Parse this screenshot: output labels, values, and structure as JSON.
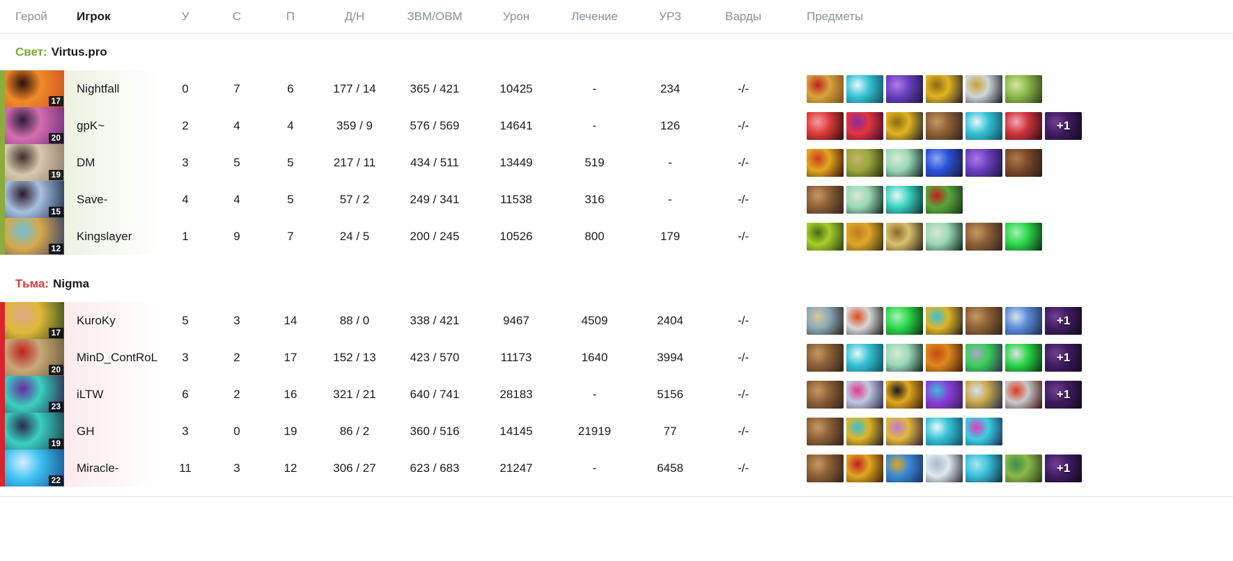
{
  "columns": {
    "hero": "Герой",
    "player": "Игрок",
    "kills": "У",
    "deaths": "С",
    "assists": "П",
    "last_hits_denies": "Д/Н",
    "gpm_xpm": "ЗВМ/ОВМ",
    "damage": "Урон",
    "healing": "Лечение",
    "hero_damage": "УРЗ",
    "wards": "Варды",
    "items": "Предметы"
  },
  "colors": {
    "radiant": "#7aa832",
    "dire": "#e2373f",
    "radiant_bar": "#8aad3b",
    "dire_bar": "#d9232e",
    "radiant_row": "#e7eed9",
    "dire_row": "#fae3e5",
    "header_text": "#8b9099",
    "body_text": "#1b1b1b"
  },
  "teams": [
    {
      "side_label": "Свет:",
      "side": "radiant",
      "name": "Virtus.pro",
      "players": [
        {
          "name": "Nightfall",
          "level": "17",
          "hero_colors": [
            "#d1521c",
            "#f08a2a",
            "#2a0f08"
          ],
          "kills": "0",
          "deaths": "7",
          "assists": "6",
          "last_hits_denies": "177 / 14",
          "gpm_xpm": "365 / 421",
          "damage": "10425",
          "healing": "-",
          "hero_damage": "234",
          "wards": "-/-",
          "items": [
            {
              "colors": [
                "#7a4a1d",
                "#d8a43a",
                "#c02020"
              ]
            },
            {
              "colors": [
                "#0e4a58",
                "#35c3d6",
                "#eaf7f9"
              ]
            },
            {
              "colors": [
                "#1a1438",
                "#6a3fbf",
                "#b07ae8"
              ]
            },
            {
              "colors": [
                "#1a1a2a",
                "#e0b422",
                "#8d6a12"
              ]
            },
            {
              "colors": [
                "#0f1a22",
                "#cfd6d8",
                "#c9a23a"
              ]
            },
            {
              "colors": [
                "#2a3a18",
                "#8bb84a",
                "#d7e4a0"
              ]
            }
          ],
          "extra_items": null
        },
        {
          "name": "gpK~",
          "level": "20",
          "hero_colors": [
            "#6b2a7a",
            "#d46fae",
            "#2b1c3a"
          ],
          "kills": "2",
          "deaths": "4",
          "assists": "4",
          "last_hits_denies": "359 / 9",
          "gpm_xpm": "576 / 569",
          "damage": "14641",
          "healing": "-",
          "hero_damage": "126",
          "wards": "-/-",
          "items": [
            {
              "colors": [
                "#2a0c0c",
                "#e03b3b",
                "#f2a0a0"
              ]
            },
            {
              "colors": [
                "#3a0a2a",
                "#e2353f",
                "#8a2aa0"
              ]
            },
            {
              "colors": [
                "#1a1a2a",
                "#e0b422",
                "#8d6a12"
              ]
            },
            {
              "colors": [
                "#2e2018",
                "#8c6038",
                "#c79a62"
              ]
            },
            {
              "colors": [
                "#0e4a58",
                "#35c3d6",
                "#eaf7f9"
              ]
            },
            {
              "colors": [
                "#2a0c14",
                "#d0343f",
                "#f0a8b0"
              ]
            }
          ],
          "extra_items": "+1"
        },
        {
          "name": "DM",
          "level": "19",
          "hero_colors": [
            "#8a7a66",
            "#d8c8b0",
            "#3a3028"
          ],
          "kills": "3",
          "deaths": "5",
          "assists": "5",
          "last_hits_denies": "217 / 11",
          "gpm_xpm": "434 / 511",
          "damage": "13449",
          "healing": "519",
          "hero_damage": "-",
          "wards": "-/-",
          "items": [
            {
              "colors": [
                "#3a0c08",
                "#e0a820",
                "#d03a20"
              ]
            },
            {
              "colors": [
                "#2a2a12",
                "#9aa83a",
                "#c8b070"
              ]
            },
            {
              "colors": [
                "#0c2018",
                "#9ad8b8",
                "#d8e8d0"
              ]
            },
            {
              "colors": [
                "#1a1438",
                "#2a52d8",
                "#8aa8f0"
              ]
            },
            {
              "colors": [
                "#1a1438",
                "#6a3fbf",
                "#b07ae8"
              ]
            },
            {
              "colors": [
                "#2a1a12",
                "#7a4a2a",
                "#b07a48"
              ]
            }
          ],
          "extra_items": null
        },
        {
          "name": "Save-",
          "level": "15",
          "hero_colors": [
            "#1a2a4a",
            "#a8c0e0",
            "#2a1a2a"
          ],
          "kills": "4",
          "deaths": "4",
          "assists": "5",
          "last_hits_denies": "57 / 2",
          "gpm_xpm": "249 / 341",
          "damage": "11538",
          "healing": "316",
          "hero_damage": "-",
          "wards": "-/-",
          "items": [
            {
              "colors": [
                "#2e2018",
                "#8c6038",
                "#c79a62"
              ]
            },
            {
              "colors": [
                "#0c2018",
                "#9ad8b8",
                "#d8e8d0"
              ]
            },
            {
              "colors": [
                "#0c2a28",
                "#3ad0c0",
                "#eafaf8"
              ]
            },
            {
              "colors": [
                "#16301a",
                "#5aa83a",
                "#c02020"
              ]
            }
          ],
          "extra_items": null
        },
        {
          "name": "Kingslayer",
          "level": "12",
          "hero_colors": [
            "#2a3a6a",
            "#d8a84a",
            "#6ac0d8"
          ],
          "kills": "1",
          "deaths": "9",
          "assists": "7",
          "last_hits_denies": "24 / 5",
          "gpm_xpm": "200 / 245",
          "damage": "10526",
          "healing": "800",
          "hero_damage": "179",
          "wards": "-/-",
          "items": [
            {
              "colors": [
                "#2a3a10",
                "#a8d02a",
                "#4a6a12"
              ]
            },
            {
              "colors": [
                "#3a2a10",
                "#e0a82a",
                "#c07a20"
              ]
            },
            {
              "colors": [
                "#2a2010",
                "#d8c070",
                "#8a6a28"
              ]
            },
            {
              "colors": [
                "#0c2018",
                "#9ad8b8",
                "#d8e8d0"
              ]
            },
            {
              "colors": [
                "#2e2018",
                "#8c6038",
                "#c79a62"
              ]
            },
            {
              "colors": [
                "#0c2a12",
                "#2ad84a",
                "#a8f0b8"
              ]
            }
          ],
          "extra_items": null
        }
      ]
    },
    {
      "side_label": "Тьма:",
      "side": "dire",
      "name": "Nigma",
      "players": [
        {
          "name": "KuroKy",
          "level": "17",
          "hero_colors": [
            "#2a4a18",
            "#e0b83a",
            "#d8a888"
          ],
          "kills": "5",
          "deaths": "3",
          "assists": "14",
          "last_hits_denies": "88 / 0",
          "gpm_xpm": "338 / 421",
          "damage": "9467",
          "healing": "4509",
          "hero_damage": "2404",
          "wards": "-/-",
          "items": [
            {
              "colors": [
                "#2a2018",
                "#8aa8b8",
                "#d8c8a0"
              ]
            },
            {
              "colors": [
                "#1a1a1a",
                "#d8d8d8",
                "#e04a20"
              ]
            },
            {
              "colors": [
                "#0c2a0c",
                "#2ad84a",
                "#a8f0b8"
              ]
            },
            {
              "colors": [
                "#1a1a2a",
                "#e0b422",
                "#3ac0d8"
              ]
            },
            {
              "colors": [
                "#2e2018",
                "#8c6038",
                "#c79a62"
              ]
            },
            {
              "colors": [
                "#1a2a4a",
                "#5a8ad8",
                "#d8e4f0"
              ]
            }
          ],
          "extra_items": "+1"
        },
        {
          "name": "MinD_ContRoL",
          "level": "20",
          "hero_colors": [
            "#6a5a3a",
            "#c8a878",
            "#c02020"
          ],
          "kills": "3",
          "deaths": "2",
          "assists": "17",
          "last_hits_denies": "152 / 13",
          "gpm_xpm": "423 / 570",
          "damage": "11173",
          "healing": "1640",
          "hero_damage": "3994",
          "wards": "-/-",
          "items": [
            {
              "colors": [
                "#2e2018",
                "#8c6038",
                "#c79a62"
              ]
            },
            {
              "colors": [
                "#0e4a58",
                "#35c3d6",
                "#eaf7f9"
              ]
            },
            {
              "colors": [
                "#0c2018",
                "#9ad8b8",
                "#d8e8d0"
              ]
            },
            {
              "colors": [
                "#3a1a08",
                "#e08a20",
                "#c04a10"
              ]
            },
            {
              "colors": [
                "#2a2a4a",
                "#3ad05a",
                "#a8a8c8"
              ]
            },
            {
              "colors": [
                "#0c2a0c",
                "#2ad84a",
                "#e0e0e0"
              ]
            }
          ],
          "extra_items": "+1"
        },
        {
          "name": "iLTW",
          "level": "23",
          "hero_colors": [
            "#2a1a4a",
            "#3ad0c0",
            "#6a2aa0"
          ],
          "kills": "6",
          "deaths": "2",
          "assists": "16",
          "last_hits_denies": "321 / 21",
          "gpm_xpm": "640 / 741",
          "damage": "28183",
          "healing": "-",
          "hero_damage": "5156",
          "wards": "-/-",
          "items": [
            {
              "colors": [
                "#2e2018",
                "#8c6038",
                "#c79a62"
              ]
            },
            {
              "colors": [
                "#2a2a4a",
                "#c0c8e0",
                "#e03a8a"
              ]
            },
            {
              "colors": [
                "#3a1a08",
                "#e0a820",
                "#1a1a1a"
              ]
            },
            {
              "colors": [
                "#3a1a5a",
                "#8a3fd8",
                "#3ac0d8"
              ]
            },
            {
              "colors": [
                "#1a2a4a",
                "#c8a84a",
                "#d8e4f0"
              ]
            },
            {
              "colors": [
                "#3a0c0c",
                "#c8c8c8",
                "#e03a20"
              ]
            }
          ],
          "extra_items": "+1"
        },
        {
          "name": "GH",
          "level": "19",
          "hero_colors": [
            "#1a3a4a",
            "#3ad0c0",
            "#2a2a4a"
          ],
          "kills": "3",
          "deaths": "0",
          "assists": "19",
          "last_hits_denies": "86 / 2",
          "gpm_xpm": "360 / 516",
          "damage": "14145",
          "healing": "21919",
          "hero_damage": "77",
          "wards": "-/-",
          "items": [
            {
              "colors": [
                "#2e2018",
                "#8c6038",
                "#c79a62"
              ]
            },
            {
              "colors": [
                "#1a1a2a",
                "#e0b422",
                "#3ac0d8"
              ]
            },
            {
              "colors": [
                "#2a1a3a",
                "#e0b83a",
                "#c07ad8"
              ]
            },
            {
              "colors": [
                "#0e4a58",
                "#35c3d6",
                "#eaf7f9"
              ]
            },
            {
              "colors": [
                "#1a2a5a",
                "#3ad0e0",
                "#e03ac0"
              ]
            }
          ],
          "extra_items": null
        },
        {
          "name": "Miracle-",
          "level": "22",
          "hero_colors": [
            "#1a4a8a",
            "#3ac0f0",
            "#d8f0ff"
          ],
          "kills": "11",
          "deaths": "3",
          "assists": "12",
          "last_hits_denies": "306 / 27",
          "gpm_xpm": "623 / 683",
          "damage": "21247",
          "healing": "-",
          "hero_damage": "6458",
          "wards": "-/-",
          "items": [
            {
              "colors": [
                "#2e2018",
                "#8c6038",
                "#c79a62"
              ]
            },
            {
              "colors": [
                "#3a1a08",
                "#e0a820",
                "#c02020"
              ]
            },
            {
              "colors": [
                "#1a2a5a",
                "#3a8ad8",
                "#e0a820"
              ]
            },
            {
              "colors": [
                "#2a2a3a",
                "#e0e8f0",
                "#a8b8c8"
              ]
            },
            {
              "colors": [
                "#0c2a3a",
                "#3ac0d8",
                "#a8e8f0"
              ]
            },
            {
              "colors": [
                "#2a3a18",
                "#8bb84a",
                "#3a8a4a"
              ]
            }
          ],
          "extra_items": "+1"
        }
      ]
    }
  ]
}
